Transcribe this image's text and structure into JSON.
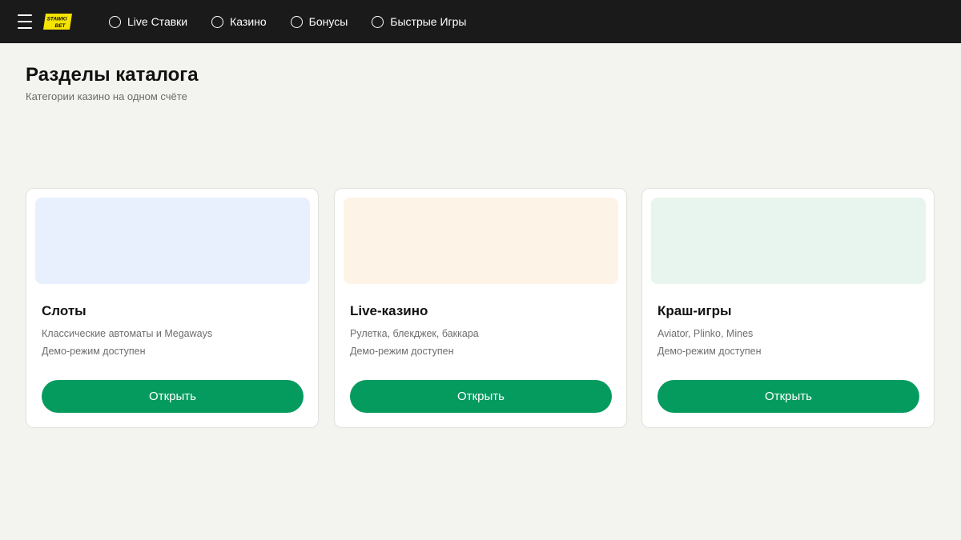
{
  "header": {
    "logo_text": "STAWKI BET",
    "nav": [
      {
        "label": "Live Ставки"
      },
      {
        "label": "Казино"
      },
      {
        "label": "Бонусы"
      },
      {
        "label": "Быстрые Игры"
      }
    ]
  },
  "page": {
    "title": "Разделы каталога",
    "subtitle": "Категории казино на одном счёте"
  },
  "cards": [
    {
      "title": "Слоты",
      "description": "Классические автоматы и Megaways",
      "demo": "Демо-режим доступен",
      "button": "Открыть",
      "thumb_color": "#e8effd"
    },
    {
      "title": "Live-казино",
      "description": "Рулетка, блекджек, баккара",
      "demo": "Демо-режим доступен",
      "button": "Открыть",
      "thumb_color": "#fdf3e6"
    },
    {
      "title": "Краш-игры",
      "description": "Aviator, Plinko, Mines",
      "demo": "Демо-режим доступен",
      "button": "Открыть",
      "thumb_color": "#e8f5ee"
    }
  ],
  "colors": {
    "header_bg": "#1a1a1a",
    "page_bg": "#f3f3ef",
    "accent": "#069b5e",
    "logo_yellow": "#f5e300"
  },
  "icons": {
    "menu": "hamburger-menu-icon",
    "nav": "circle-icon"
  }
}
